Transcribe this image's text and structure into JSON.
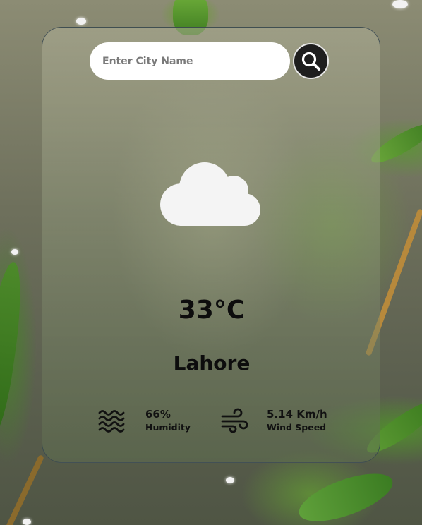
{
  "search": {
    "placeholder": "Enter City Name",
    "value": "",
    "button_icon": "search-icon"
  },
  "weather": {
    "icon": "cloud-icon",
    "temperature": "33°C",
    "city": "Lahore"
  },
  "details": {
    "humidity": {
      "icon": "humidity-waves-icon",
      "value": "66%",
      "label": "Humidity"
    },
    "wind": {
      "icon": "wind-icon",
      "value": "5.14 Km/h",
      "label": "Wind Speed"
    }
  },
  "colors": {
    "card_border": "#37464f",
    "text": "#0d0d0d",
    "search_button": "#1e1e1e",
    "cloud": "#f4f4f4"
  }
}
